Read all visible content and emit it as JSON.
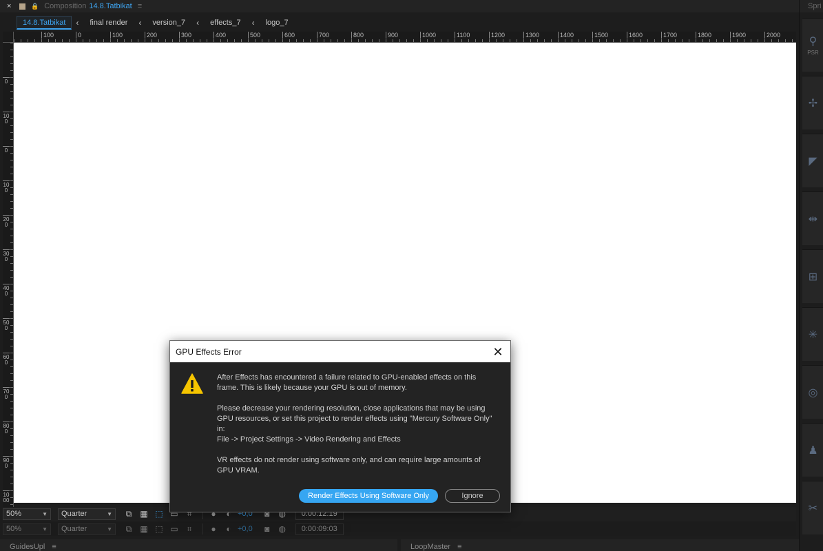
{
  "panel": {
    "close_glyph": "×",
    "tab_label": "Composition",
    "tab_name": "14.8.Tatbikat",
    "menu_glyph": "≡"
  },
  "breadcrumbs": {
    "active": "14.8.Tatbikat",
    "items": [
      "final render",
      "version_7",
      "effects_7",
      "logo_7"
    ],
    "separator": "‹"
  },
  "ruler": {
    "h_labels": [
      "100",
      "0",
      "100",
      "200",
      "300",
      "400",
      "500",
      "600",
      "700",
      "800",
      "900",
      "1000",
      "1100",
      "1200",
      "1300",
      "1400",
      "1500",
      "1600",
      "1700",
      "1800",
      "1900",
      "2000"
    ],
    "v_labels": [
      "0",
      "100",
      "0",
      "100",
      "200",
      "300",
      "400",
      "500",
      "600",
      "700",
      "800",
      "900",
      "1000",
      "1100"
    ]
  },
  "toolbar": {
    "zoom": "50%",
    "resolution": "Quarter",
    "exposure": "+0,0",
    "timecode": "0:00:12:19"
  },
  "toolbar2": {
    "zoom": "50%",
    "resolution": "Quarter",
    "exposure": "+0,0",
    "timecode": "0:00:09:03"
  },
  "bottom_panels": {
    "left_title": "GuidesUpl",
    "right_title": "LoopMaster",
    "menu_glyph": "≡"
  },
  "side_panel": {
    "title": "Spri",
    "first_label": "PSR"
  },
  "dialog": {
    "title": "GPU Effects Error",
    "close_glyph": "✕",
    "paragraphs": [
      "After Effects has encountered a failure related to GPU-enabled effects on this frame. This is likely because your GPU is out of memory.",
      "Please decrease your rendering resolution, close applications that may be using GPU resources, or set this project to render effects using \"Mercury Software Only\" in:",
      "VR effects do not render using software only, and can require large amounts of GPU VRAM."
    ],
    "path_line": "File -> Project Settings -> Video Rendering and Effects",
    "primary_button": "Render Effects Using Software Only",
    "secondary_button": "Ignore",
    "warning_color": "#f5c400",
    "primary_color": "#36a6f2"
  }
}
